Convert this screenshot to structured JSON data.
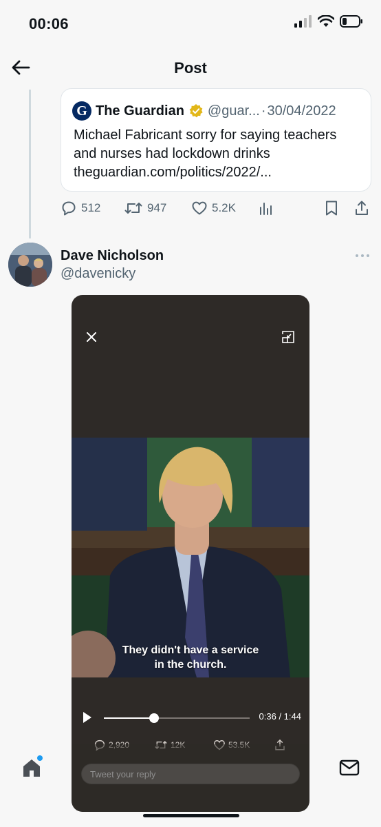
{
  "status_bar": {
    "time": "00:06"
  },
  "header": {
    "title": "Post"
  },
  "quoted_tweet": {
    "source_logo_letter": "G",
    "source_name": "The Guardian",
    "handle": "@guar...",
    "separator": "·",
    "date": "30/04/2022",
    "text": "Michael Fabricant sorry for saying teachers and nurses had lockdown drinks theguardian.com/politics/2022/..."
  },
  "actions": {
    "replies": "512",
    "retweets": "947",
    "likes": "5.2K"
  },
  "reply_tweet": {
    "author_name": "Dave Nicholson",
    "author_handle": "@davenicky"
  },
  "video": {
    "subtitle_line1": "They didn't have a service",
    "subtitle_line2": "in the church.",
    "time_display": "0:36 / 1:44",
    "progress": 0.346,
    "stats": {
      "replies": "2,920",
      "retweets": "12K",
      "likes": "53.5K"
    }
  },
  "reply_bar": {
    "placeholder": "Tweet your reply"
  },
  "icons": {
    "back": "arrow-left-icon",
    "verified": "verified-badge-icon",
    "reply": "reply-icon",
    "retweet": "retweet-icon",
    "like": "heart-icon",
    "views": "analytics-icon",
    "bookmark": "bookmark-icon",
    "share": "share-icon",
    "more": "more-icon",
    "close": "close-icon",
    "minimize": "minimize-icon",
    "play": "play-icon",
    "home": "home-icon",
    "search": "search-icon",
    "compose": "compose-icon",
    "communities": "communities-icon",
    "notifications": "bell-icon",
    "messages": "mail-icon"
  },
  "colors": {
    "accent": "#1d9bf0",
    "verified_gold": "#e2b719",
    "muted": "#536471",
    "video_bg": "#2e2a27"
  }
}
